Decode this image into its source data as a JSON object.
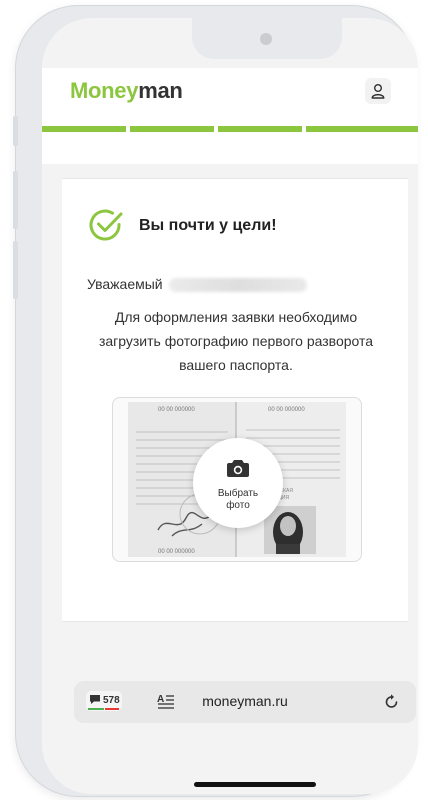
{
  "app": {
    "logo_part1": "Money",
    "logo_part2": "man",
    "brand_color": "#8cc63f"
  },
  "header": {
    "user_icon": "user-icon"
  },
  "progress": {
    "steps_total": 4,
    "steps_done": 4
  },
  "content": {
    "title": "Вы почти у цели!",
    "greeting": "Уважаемый",
    "instructions": "Для оформления заявки необходимо загрузить фотографию первого разворота вашего паспорта.",
    "upload_button": "Выбрать\nфото"
  },
  "browser": {
    "tab_count": "578",
    "url": "moneyman.ru",
    "reader_icon": "reader-mode-icon",
    "reload_icon": "reload-icon"
  }
}
